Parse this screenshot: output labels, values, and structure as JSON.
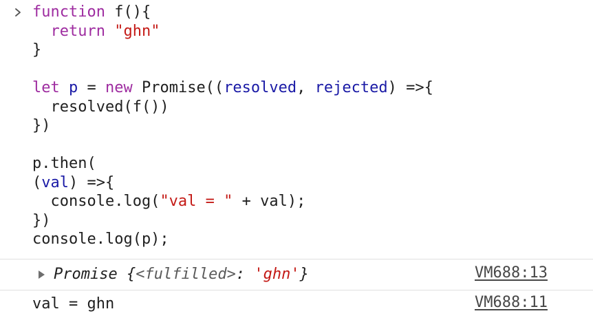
{
  "console": {
    "prompt_icon": "chevron-right-icon",
    "input": {
      "lines": [
        [
          {
            "t": "function ",
            "c": "kw"
          },
          {
            "t": "f(){",
            "c": "def"
          }
        ],
        [
          {
            "t": "  ",
            "c": "def"
          },
          {
            "t": "return ",
            "c": "kw"
          },
          {
            "t": "\"ghn\"",
            "c": "str"
          }
        ],
        [
          {
            "t": "}",
            "c": "def"
          }
        ],
        [],
        [
          {
            "t": "let ",
            "c": "kw"
          },
          {
            "t": "p",
            "c": "var"
          },
          {
            "t": " = ",
            "c": "def"
          },
          {
            "t": "new ",
            "c": "kw"
          },
          {
            "t": "Promise((",
            "c": "def"
          },
          {
            "t": "resolved",
            "c": "var"
          },
          {
            "t": ", ",
            "c": "def"
          },
          {
            "t": "rejected",
            "c": "var"
          },
          {
            "t": ") =>{",
            "c": "def"
          }
        ],
        [
          {
            "t": "  resolved(f())",
            "c": "def"
          }
        ],
        [
          {
            "t": "})",
            "c": "def"
          }
        ],
        [],
        [
          {
            "t": "p.then(",
            "c": "def"
          }
        ],
        [
          {
            "t": "(",
            "c": "def"
          },
          {
            "t": "val",
            "c": "var"
          },
          {
            "t": ") =>{",
            "c": "def"
          }
        ],
        [
          {
            "t": "  console.log(",
            "c": "def"
          },
          {
            "t": "\"val = \"",
            "c": "str"
          },
          {
            "t": " + val);",
            "c": "def"
          }
        ],
        [
          {
            "t": "})",
            "c": "def"
          }
        ],
        [
          {
            "t": "console.log(p);",
            "c": "def"
          }
        ]
      ]
    },
    "outputs": {
      "promise": {
        "expand_icon": "triangle-right-icon",
        "name": "Promise",
        "open_brace": " {",
        "key": "<fulfilled>",
        "colon": ": ",
        "value": "'ghn'",
        "close_brace": "}",
        "source": "VM688:13"
      },
      "log": {
        "text": "val = ghn",
        "source": "VM688:11"
      }
    }
  }
}
